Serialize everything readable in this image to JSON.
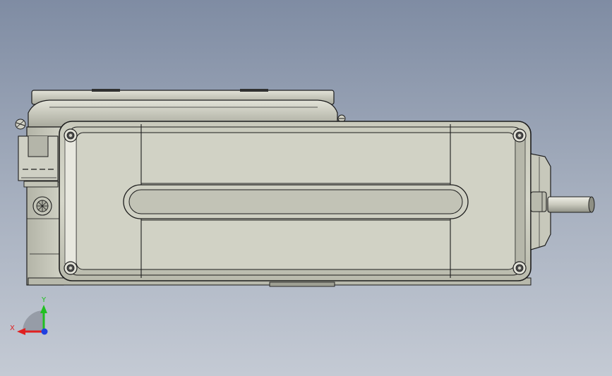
{
  "viewport": {
    "background_top": "#7f8ca3",
    "background_bottom": "#c4cad4"
  },
  "triad": {
    "x_label": "X",
    "y_label": "Y",
    "x_color": "#e02020",
    "y_color": "#20c020",
    "z_color": "#2040e0"
  }
}
